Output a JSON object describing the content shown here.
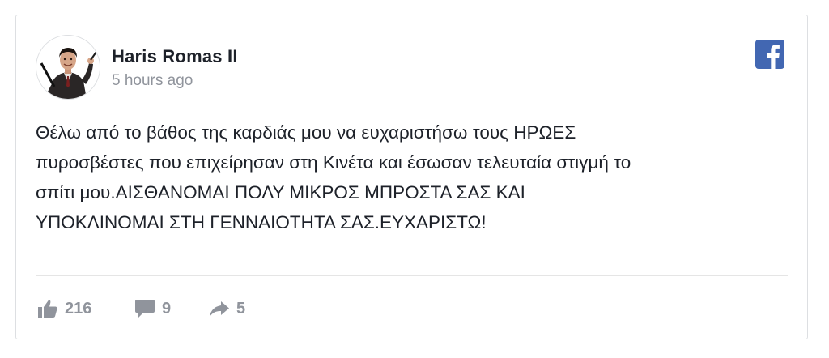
{
  "post": {
    "author": "Haris Romas II",
    "time": "5 hours ago",
    "text": "Θέλω από το βάθος της καρδιάς μου να ευχαριστήσω τους ΗΡΩΕΣ\nπυροσβέστες που επιχείρησαν στη Κινέτα και έσωσαν τελευταία στιγμή το\nσπίτι μου.ΑΙΣΘΑΝΟΜΑΙ ΠΟΛΥ ΜΙΚΡΟΣ ΜΠΡΟΣΤΑ ΣΑΣ ΚΑΙ\nΥΠΟΚΛΙΝΟΜΑΙ ΣΤΗ ΓΕΝΝΑΙΟΤΗΤΑ ΣΑΣ.ΕΥΧΑΡΙΣΤΩ!"
  },
  "stats": {
    "likes": "216",
    "comments": "9",
    "shares": "5"
  },
  "icons": {
    "brand": "facebook-icon",
    "like": "thumbs-up-icon",
    "comment": "comment-bubble-icon",
    "share": "share-arrow-icon"
  },
  "colors": {
    "facebook_blue": "#4267b2",
    "meta_gray": "#90949c",
    "text": "#1d2129",
    "border": "#dddfe2"
  }
}
